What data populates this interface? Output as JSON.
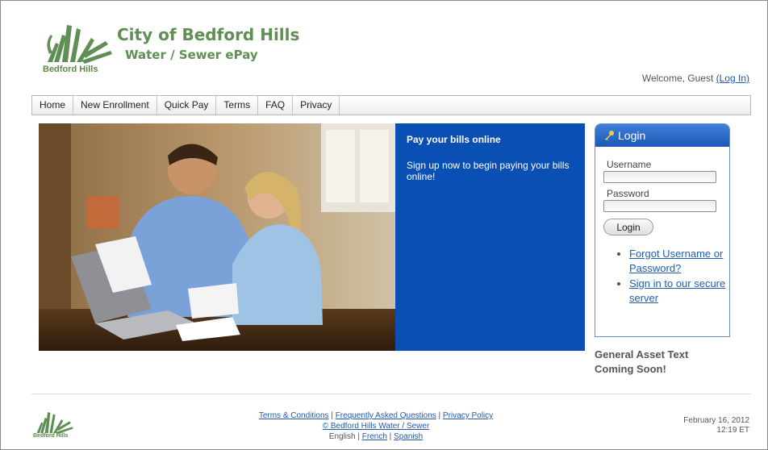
{
  "brand": {
    "title": "City of Bedford Hills",
    "subtitle": "Water / Sewer ePay",
    "logo_text": "Bedford Hills",
    "color": "#5f8f55"
  },
  "welcome": {
    "text": "Welcome, Guest ",
    "login_link": "(Log In)"
  },
  "nav": {
    "items": [
      "Home",
      "New Enrollment",
      "Quick Pay",
      "Terms",
      "FAQ",
      "Privacy"
    ]
  },
  "promo": {
    "title": "Pay your bills online",
    "text": "Sign up now to begin paying your bills online!",
    "color": "#0a4fb4"
  },
  "login": {
    "heading": "Login",
    "username_label": "Username",
    "username_value": "",
    "password_label": "Password",
    "password_value": "",
    "button": "Login",
    "links": [
      "Forgot Username or Password?",
      "Sign in to our secure server"
    ],
    "header_color": "#1c58b6"
  },
  "asset_text": "General Asset Text Coming Soon!",
  "footer": {
    "terms": "Terms & Conditions",
    "faq": "Frequently Asked Questions",
    "privacy": "Privacy Policy",
    "copyright": "© Bedford Hills Water / Sewer",
    "language_current": "English",
    "lang_french": "French",
    "lang_spanish": "Spanish",
    "logo_text": "Bedford Hills",
    "date": "February 16, 2012",
    "time": "12:19 ET"
  },
  "icons": {
    "brand": "swoosh-logo-icon",
    "login": "key-icon"
  }
}
